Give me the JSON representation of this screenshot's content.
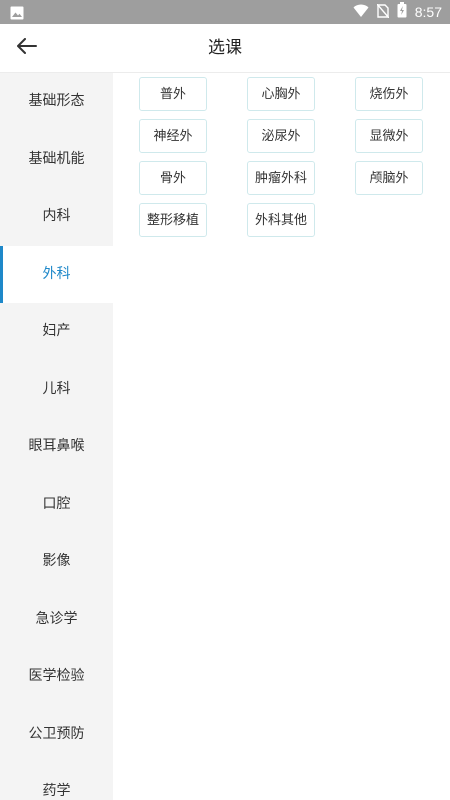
{
  "status_bar": {
    "time": "8:57",
    "icons": [
      "image-icon",
      "wifi-icon",
      "no-sim-icon",
      "battery-icon"
    ]
  },
  "app_bar": {
    "title": "选课",
    "back_icon": "arrow-back-icon"
  },
  "sidebar": {
    "active_index": 3,
    "items": [
      {
        "label": "基础形态"
      },
      {
        "label": "基础机能"
      },
      {
        "label": "内科"
      },
      {
        "label": "外科"
      },
      {
        "label": "妇产"
      },
      {
        "label": "儿科"
      },
      {
        "label": "眼耳鼻喉"
      },
      {
        "label": "口腔"
      },
      {
        "label": "影像"
      },
      {
        "label": "急诊学"
      },
      {
        "label": "医学检验"
      },
      {
        "label": "公卫预防"
      },
      {
        "label": "药学"
      }
    ]
  },
  "courses": [
    {
      "label": "普外"
    },
    {
      "label": "心胸外"
    },
    {
      "label": "烧伤外"
    },
    {
      "label": "神经外"
    },
    {
      "label": "泌尿外"
    },
    {
      "label": "显微外"
    },
    {
      "label": "骨外"
    },
    {
      "label": "肿瘤外科"
    },
    {
      "label": "颅脑外"
    },
    {
      "label": "整形移植"
    },
    {
      "label": "外科其他"
    }
  ],
  "colors": {
    "accent": "#1e88c9",
    "status_bar": "#9e9e9e",
    "sidebar_bg": "#f4f4f4",
    "tag_border": "#cfe9ec"
  }
}
